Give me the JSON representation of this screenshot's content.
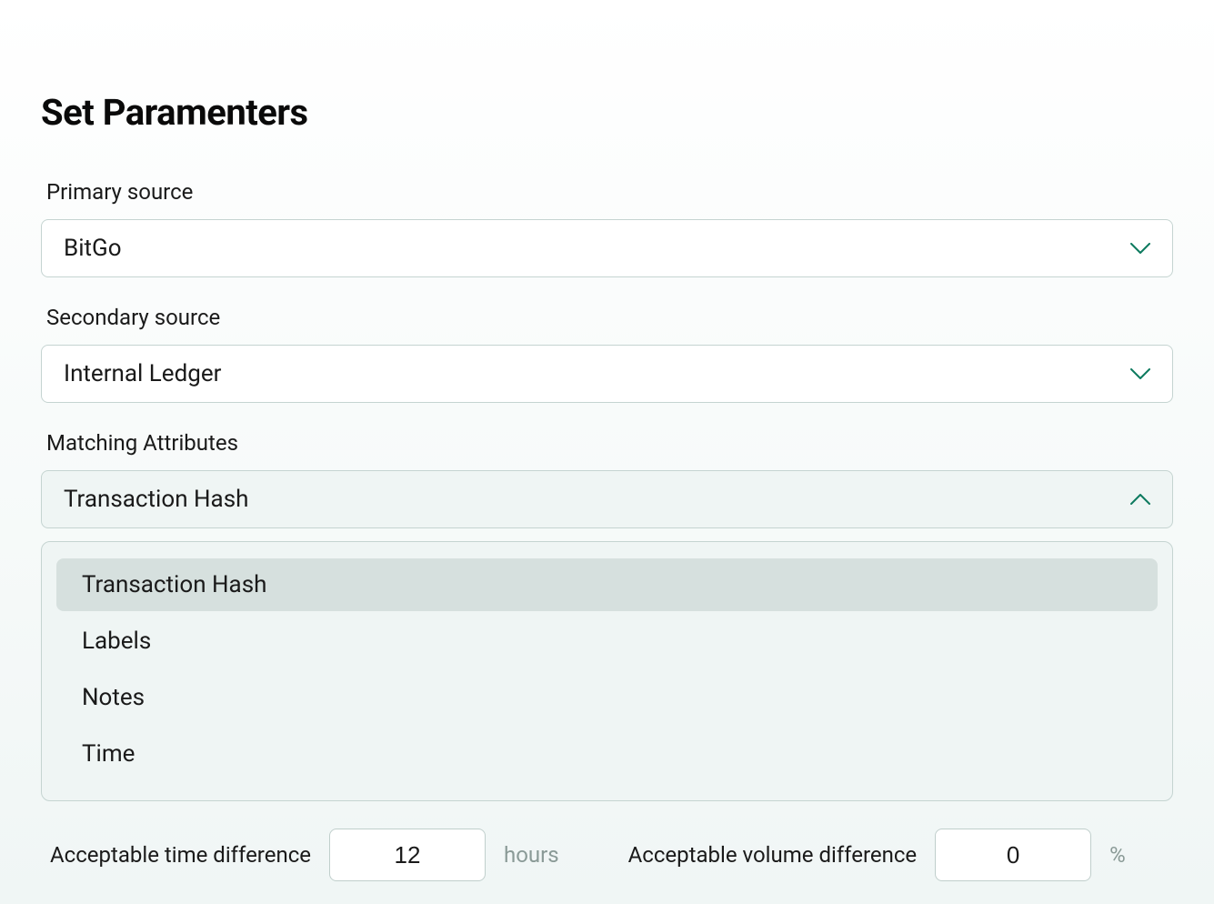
{
  "title": "Set Paramenters",
  "primary_source": {
    "label": "Primary source",
    "value": "BitGo"
  },
  "secondary_source": {
    "label": "Secondary source",
    "value": "Internal Ledger"
  },
  "matching_attributes": {
    "label": "Matching Attributes",
    "value": "Transaction Hash",
    "options": [
      {
        "label": "Transaction Hash",
        "selected": true
      },
      {
        "label": "Labels",
        "selected": false
      },
      {
        "label": "Notes",
        "selected": false
      },
      {
        "label": "Time",
        "selected": false
      }
    ]
  },
  "time_diff": {
    "label": "Acceptable time difference",
    "value": "12",
    "unit": "hours"
  },
  "volume_diff": {
    "label": "Acceptable volume difference",
    "value": "0",
    "unit": "%"
  },
  "colors": {
    "chevron": "#0d7a5f"
  }
}
